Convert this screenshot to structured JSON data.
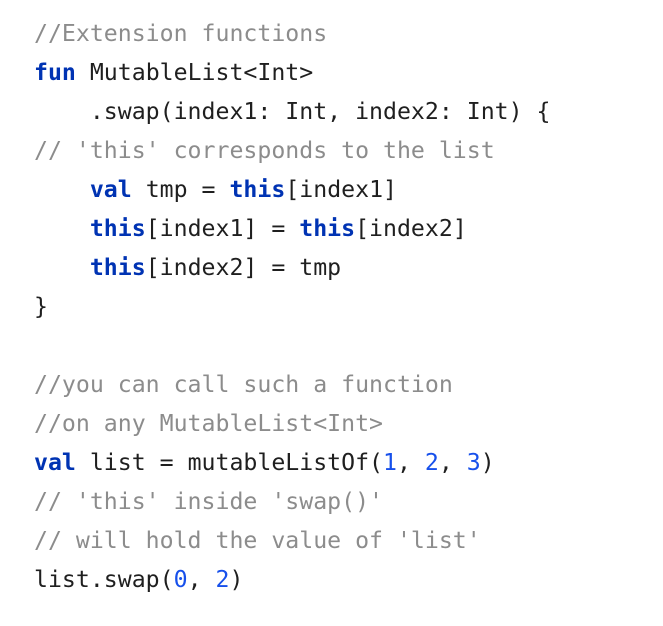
{
  "code": {
    "lines": [
      [
        {
          "t": "//Extension functions",
          "k": "comment"
        }
      ],
      [
        {
          "t": "fun",
          "k": "keyword"
        },
        {
          "t": " MutableList<Int>",
          "k": "plain"
        }
      ],
      [
        {
          "t": "    .swap(index1: Int, index2: Int) {",
          "k": "plain"
        }
      ],
      [
        {
          "t": "// 'this' corresponds to the list",
          "k": "comment"
        }
      ],
      [
        {
          "t": "    ",
          "k": "plain"
        },
        {
          "t": "val",
          "k": "keyword"
        },
        {
          "t": " tmp = ",
          "k": "plain"
        },
        {
          "t": "this",
          "k": "keyword"
        },
        {
          "t": "[index1]",
          "k": "plain"
        }
      ],
      [
        {
          "t": "    ",
          "k": "plain"
        },
        {
          "t": "this",
          "k": "keyword"
        },
        {
          "t": "[index1] = ",
          "k": "plain"
        },
        {
          "t": "this",
          "k": "keyword"
        },
        {
          "t": "[index2]",
          "k": "plain"
        }
      ],
      [
        {
          "t": "    ",
          "k": "plain"
        },
        {
          "t": "this",
          "k": "keyword"
        },
        {
          "t": "[index2] = tmp",
          "k": "plain"
        }
      ],
      [
        {
          "t": "}",
          "k": "plain"
        }
      ],
      [],
      [
        {
          "t": "//you can call such a function",
          "k": "comment"
        }
      ],
      [
        {
          "t": "//on any MutableList<Int>",
          "k": "comment"
        }
      ],
      [
        {
          "t": "val",
          "k": "keyword"
        },
        {
          "t": " list = mutableListOf(",
          "k": "plain"
        },
        {
          "t": "1",
          "k": "number"
        },
        {
          "t": ", ",
          "k": "plain"
        },
        {
          "t": "2",
          "k": "number"
        },
        {
          "t": ", ",
          "k": "plain"
        },
        {
          "t": "3",
          "k": "number"
        },
        {
          "t": ")",
          "k": "plain"
        }
      ],
      [
        {
          "t": "// 'this' inside 'swap()'",
          "k": "comment"
        }
      ],
      [
        {
          "t": "// will hold the value of 'list'",
          "k": "comment"
        }
      ],
      [
        {
          "t": "list.swap(",
          "k": "plain"
        },
        {
          "t": "0",
          "k": "number"
        },
        {
          "t": ", ",
          "k": "plain"
        },
        {
          "t": "2",
          "k": "number"
        },
        {
          "t": ")",
          "k": "plain"
        }
      ]
    ]
  },
  "colors": {
    "background": "#ffffff",
    "text": "#1f1f1f",
    "comment": "#8c8c8c",
    "keyword": "#0033b3",
    "number": "#1750eb"
  }
}
